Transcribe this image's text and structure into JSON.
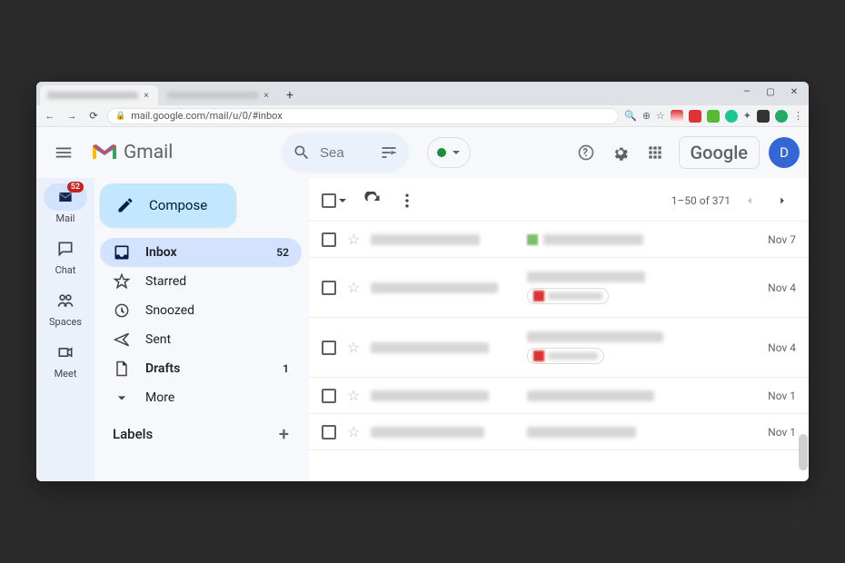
{
  "browser": {
    "url": "mail.google.com/mail/u/0/#inbox"
  },
  "header": {
    "brand": "Gmail",
    "search_placeholder": "Sea",
    "google_label": "Google",
    "avatar_letter": "D"
  },
  "rail": {
    "mail": {
      "label": "Mail",
      "badge": "52"
    },
    "chat": {
      "label": "Chat"
    },
    "spaces": {
      "label": "Spaces"
    },
    "meet": {
      "label": "Meet"
    }
  },
  "compose_label": "Compose",
  "folders": {
    "inbox": {
      "label": "Inbox",
      "count": "52"
    },
    "starred": {
      "label": "Starred"
    },
    "snoozed": {
      "label": "Snoozed"
    },
    "sent": {
      "label": "Sent"
    },
    "drafts": {
      "label": "Drafts",
      "count": "1"
    },
    "more": {
      "label": "More"
    }
  },
  "labels_header": "Labels",
  "toolbar": {
    "range": "1–50 of 371"
  },
  "rows": [
    {
      "date": "Nov 7"
    },
    {
      "date": "Nov 4"
    },
    {
      "date": "Nov 4"
    },
    {
      "date": "Nov 1"
    },
    {
      "date": "Nov 1"
    }
  ]
}
